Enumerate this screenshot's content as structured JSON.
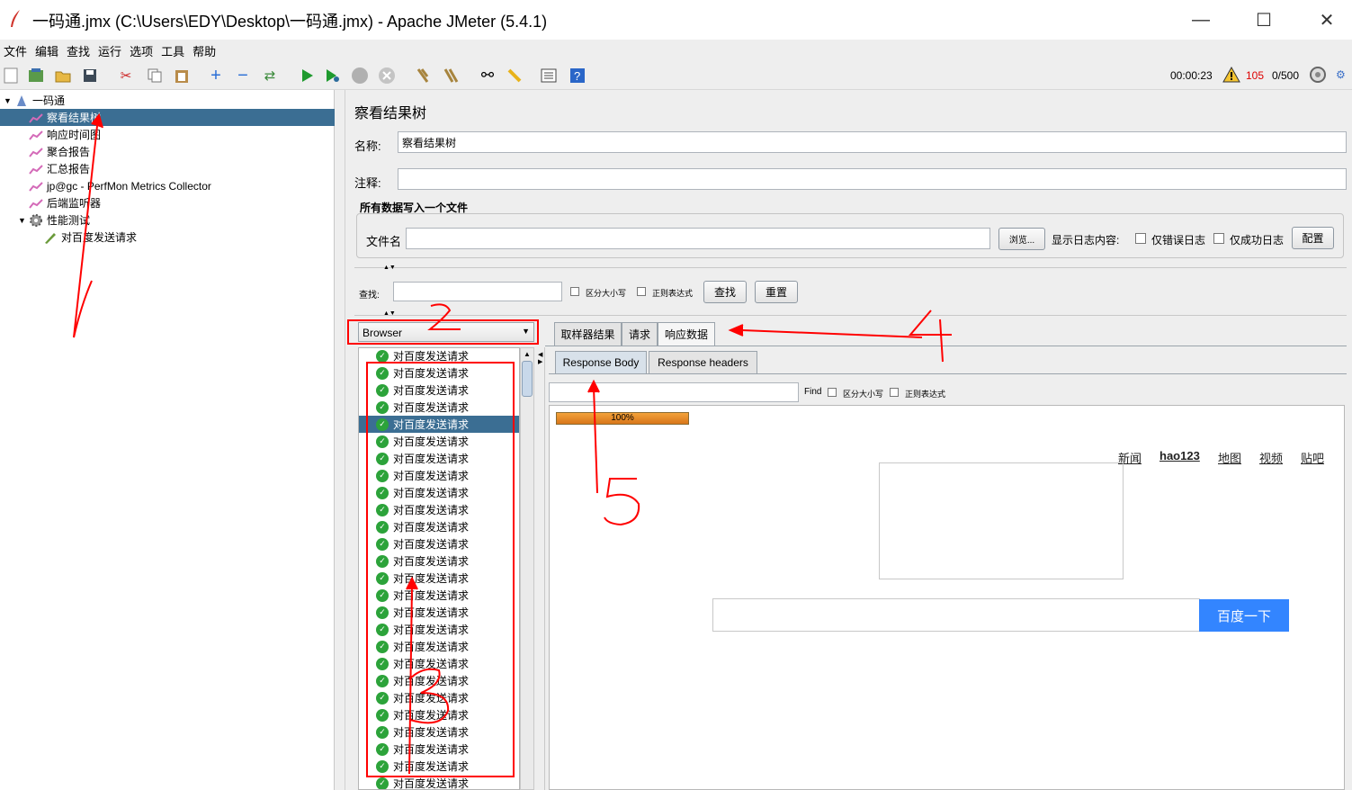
{
  "window": {
    "title": "一码通.jmx (C:\\Users\\EDY\\Desktop\\一码通.jmx) - Apache JMeter (5.4.1)"
  },
  "menu": [
    "文件",
    "编辑",
    "查找",
    "运行",
    "选项",
    "工具",
    "帮助"
  ],
  "status": {
    "elapsed": "00:00:23",
    "warnings": "105",
    "threads": "0/500"
  },
  "tree": {
    "root": "一码通",
    "items": [
      "察看结果树",
      "响应时间图",
      "聚合报告",
      "汇总报告",
      "jp@gc - PerfMon Metrics Collector",
      "后端监听器"
    ],
    "group": "性能测试",
    "sampler": "对百度发送请求"
  },
  "panel": {
    "title": "察看结果树",
    "name_label": "名称:",
    "name_value": "察看结果树",
    "comment_label": "注释:",
    "comment_value": "",
    "file_section": "所有数据写入一个文件",
    "filename_label": "文件名",
    "browse": "浏览...",
    "log_label": "显示日志内容:",
    "errors_only": "仅错误日志",
    "success_only": "仅成功日志",
    "configure": "配置",
    "search_label": "查找:",
    "case_sensitive": "区分大小写",
    "regex": "正则表达式",
    "search_btn": "查找",
    "reset_btn": "重置"
  },
  "renderer": "Browser",
  "results": {
    "label": "对百度发送请求",
    "count": 26,
    "selected_index": 4
  },
  "tabs": [
    "取样器结果",
    "请求",
    "响应数据"
  ],
  "subtabs": [
    "Response Body",
    "Response headers"
  ],
  "find": {
    "label": "Find",
    "case": "区分大小写",
    "regex": "正则表达式"
  },
  "progress": {
    "value": 1.0,
    "label": "100%"
  },
  "baidu": {
    "links": [
      "新闻",
      "hao123",
      "地图",
      "视频",
      "贴吧"
    ],
    "button": "百度一下"
  },
  "annotations": [
    "1",
    "2",
    "3",
    "4",
    "5"
  ]
}
